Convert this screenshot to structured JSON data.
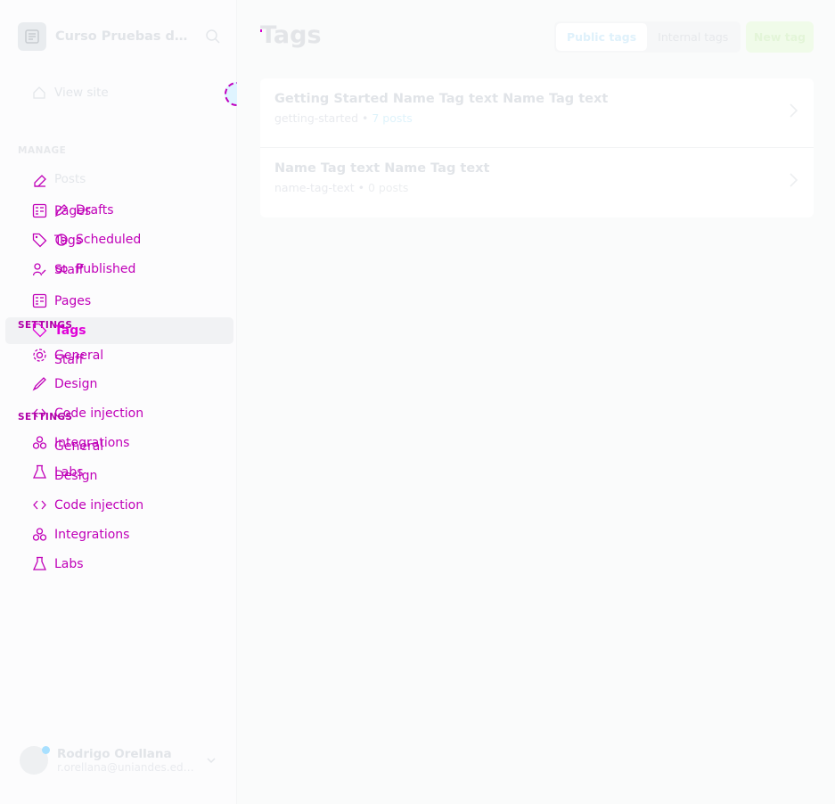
{
  "site": {
    "title": "Curso Pruebas de ..."
  },
  "nav": {
    "view_site": "View site",
    "manage_label": "MANAGE",
    "posts": "Posts",
    "pages": "Pages",
    "tags": "Tags",
    "staff": "Staff",
    "settings_label": "SETTINGS",
    "general": "General",
    "design": "Design",
    "code_injection": "Code injection",
    "integrations": "Integrations",
    "labs": "Labs"
  },
  "ghost_nav": {
    "drafts": "Drafts",
    "scheduled": "Scheduled",
    "published": "Published",
    "pages": "Pages",
    "tags": "Tags",
    "staff": "Staff",
    "settings_label": "SETTINGS",
    "general": "General",
    "design": "Design",
    "code_injection": "Code injection",
    "integrations": "Integrations",
    "labs": "Labs"
  },
  "user": {
    "name": "Rodrigo Orellana",
    "email": "r.orellana@uniandes.edu..."
  },
  "header": {
    "title": "Tags",
    "public_tags": "Public tags",
    "internal_tags": "Internal tags",
    "new_tag": "New tag"
  },
  "tags": [
    {
      "name": "Getting Started Name Tag text Name Tag text",
      "slug": "getting-started",
      "sep": "•",
      "count": "7 posts"
    },
    {
      "name": "Name Tag text Name Tag text",
      "slug": "name-tag-text",
      "sep": "•",
      "count": "0 posts"
    }
  ],
  "colors": {
    "ghost": "#c000b8",
    "accent": "#15a8ff",
    "green": "#30cf43"
  }
}
